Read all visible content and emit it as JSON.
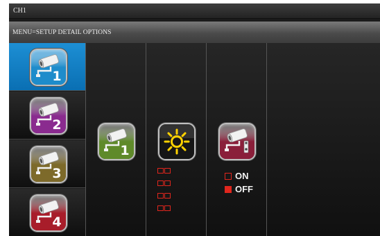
{
  "title_bar": {
    "text": "CH1"
  },
  "menu_bar": {
    "text": "MENU=SETUP DETAIL OPTIONS"
  },
  "cameras": [
    {
      "number": "1",
      "color": "#1e8ccb",
      "selected": true
    },
    {
      "number": "2",
      "color": "#8a2b8f",
      "selected": false
    },
    {
      "number": "3",
      "color": "#7d6a2a",
      "selected": false
    },
    {
      "number": "4",
      "color": "#a81d2a",
      "selected": false
    }
  ],
  "settings": {
    "pairing": {
      "icon": "camera-pair-icon",
      "color": "#5f8a2a",
      "number": "1"
    },
    "brightness": {
      "icon": "sun-icon",
      "color": "#ffd200",
      "level_boxes": 8
    },
    "record": {
      "icon": "camera-record-icon",
      "color": "#8a1f3a",
      "options": [
        {
          "label": "ON",
          "checked": false
        },
        {
          "label": "OFF",
          "checked": true
        }
      ]
    }
  },
  "colors": {
    "accent_red": "#e0261d",
    "selected_blue": "#1d8fd4"
  }
}
